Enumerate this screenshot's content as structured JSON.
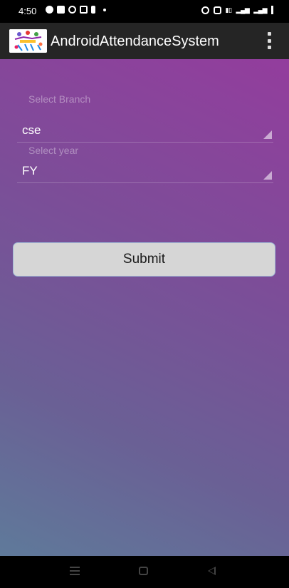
{
  "status_bar": {
    "time": "4:50",
    "left_icons": [
      "whatsapp-icon",
      "youtube-icon",
      "instagram-icon",
      "gmail-icon",
      "notification-icon"
    ],
    "right_icons": [
      "alarm-icon",
      "vibrate-icon",
      "data-icon",
      "signal-icon",
      "wifi-icon"
    ]
  },
  "app_bar": {
    "title": "AndroidAttendanceSystem",
    "logo": "app-logo-icon",
    "menu_icon": "overflow-menu-icon"
  },
  "form": {
    "branch_label": "Select Branch",
    "branch_value": "cse",
    "year_label": "Select year",
    "year_value": "FY",
    "submit_label": "Submit"
  },
  "colors": {
    "app_bar": "#252525",
    "gradient_top": "#933d9d",
    "gradient_bottom": "#5f7a9a",
    "button": "#d6d6d6"
  }
}
